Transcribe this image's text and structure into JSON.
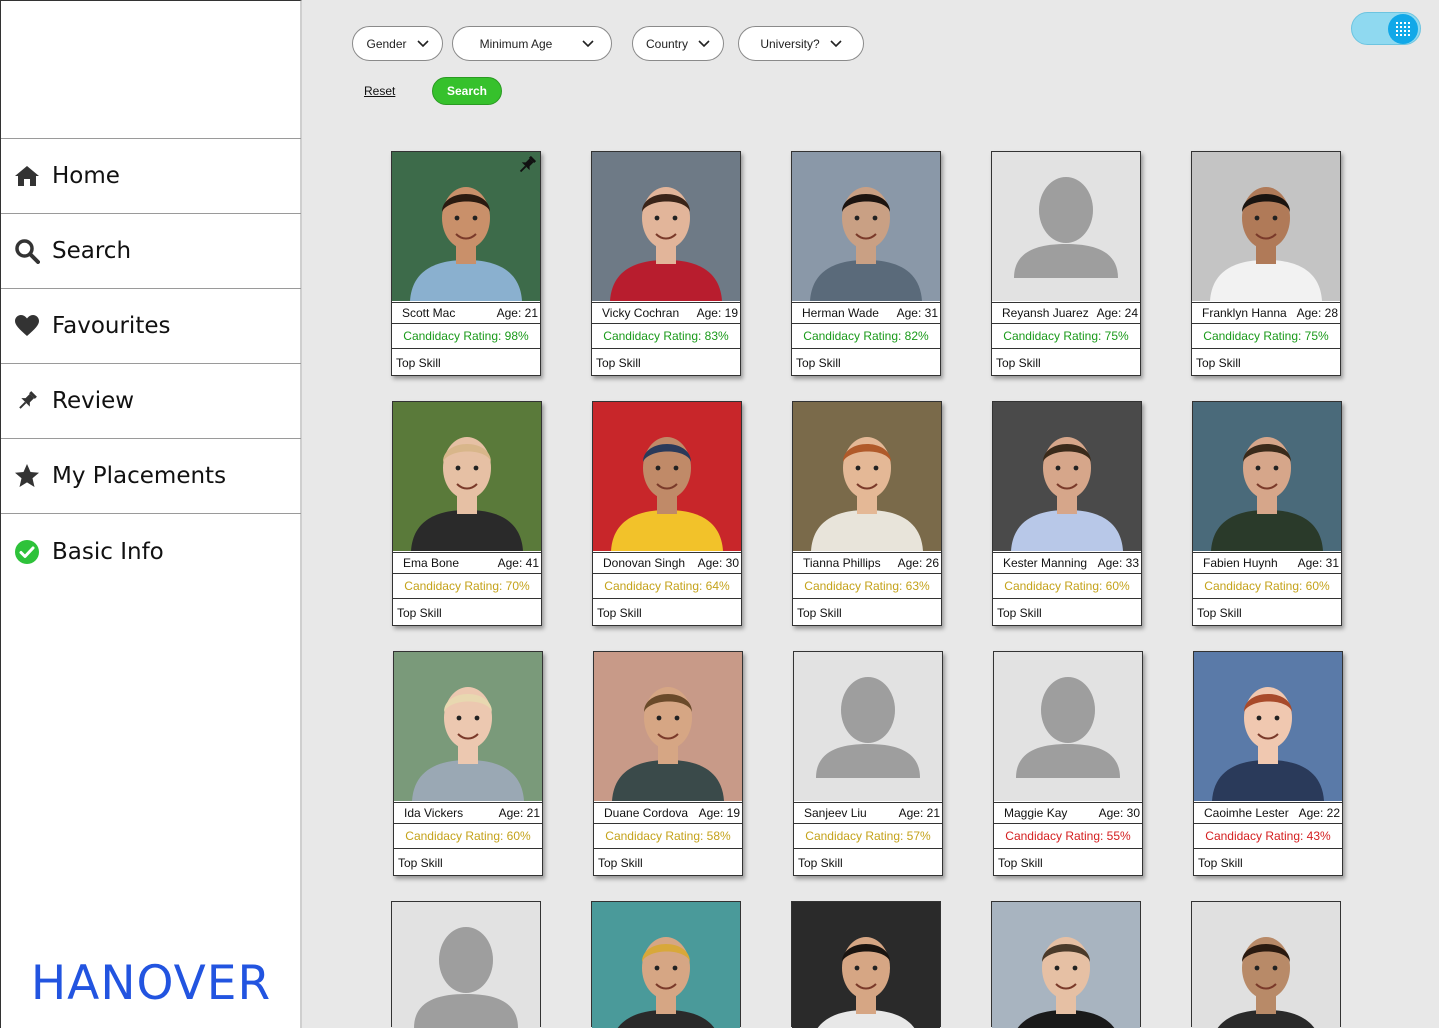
{
  "sidebar": {
    "items": [
      {
        "label": "Home",
        "icon": "home-icon"
      },
      {
        "label": "Search",
        "icon": "search-icon"
      },
      {
        "label": "Favourites",
        "icon": "heart-icon"
      },
      {
        "label": "Review",
        "icon": "pin-icon"
      },
      {
        "label": "My Placements",
        "icon": "star-icon"
      },
      {
        "label": "Basic Info",
        "icon": "check-circle-icon"
      }
    ],
    "brand": "HANOVER"
  },
  "filters": {
    "gender": "Gender",
    "min_age": "Minimum Age",
    "country": "Country",
    "university": "University?",
    "reset": "Reset",
    "search": "Search"
  },
  "colors": {
    "good": "#1a9a1a",
    "mid": "#c4a21a",
    "bad": "#d42020",
    "brand": "#2254e0",
    "search_btn": "#36c12c"
  },
  "candidates": [
    {
      "name": "Scott Mac",
      "age": "Age: 21",
      "rating": "Candidacy Rating: 98%",
      "tier": "good",
      "skill": "Top Skill",
      "pinned": true,
      "photo": true
    },
    {
      "name": "Vicky Cochran",
      "age": "Age: 19",
      "rating": "Candidacy Rating: 83%",
      "tier": "good",
      "skill": "Top Skill",
      "photo": true
    },
    {
      "name": "Herman Wade",
      "age": "Age: 31",
      "rating": "Candidacy Rating: 82%",
      "tier": "good",
      "skill": "Top Skill",
      "photo": true
    },
    {
      "name": "Reyansh Juarez",
      "age": "Age: 24",
      "rating": "Candidacy Rating: 75%",
      "tier": "good",
      "skill": "Top Skill",
      "photo": false
    },
    {
      "name": "Franklyn Hanna",
      "age": "Age: 28",
      "rating": "Candidacy Rating: 75%",
      "tier": "good",
      "skill": "Top Skill",
      "photo": true
    },
    {
      "name": "Ema Bone",
      "age": "Age: 41",
      "rating": "Candidacy Rating: 70%",
      "tier": "mid",
      "skill": "Top Skill",
      "photo": true
    },
    {
      "name": "Donovan Singh",
      "age": "Age: 30",
      "rating": "Candidacy Rating: 64%",
      "tier": "mid",
      "skill": "Top Skill",
      "photo": true
    },
    {
      "name": "Tianna Phillips",
      "age": "Age: 26",
      "rating": "Candidacy Rating: 63%",
      "tier": "mid",
      "skill": "Top Skill",
      "photo": true
    },
    {
      "name": "Kester Manning",
      "age": "Age: 33",
      "rating": "Candidacy Rating: 60%",
      "tier": "mid",
      "skill": "Top Skill",
      "photo": true
    },
    {
      "name": "Fabien Huynh",
      "age": "Age: 31",
      "rating": "Candidacy Rating: 60%",
      "tier": "mid",
      "skill": "Top Skill",
      "photo": true
    },
    {
      "name": "Ida Vickers",
      "age": "Age: 21",
      "rating": "Candidacy Rating: 60%",
      "tier": "mid",
      "skill": "Top Skill",
      "photo": true
    },
    {
      "name": "Duane Cordova",
      "age": "Age: 19",
      "rating": "Candidacy Rating: 58%",
      "tier": "mid",
      "skill": "Top Skill",
      "photo": true
    },
    {
      "name": "Sanjeev Liu",
      "age": "Age: 21",
      "rating": "Candidacy Rating: 57%",
      "tier": "mid",
      "skill": "Top Skill",
      "photo": false
    },
    {
      "name": "Maggie Kay",
      "age": "Age: 30",
      "rating": "Candidacy Rating: 55%",
      "tier": "bad",
      "skill": "Top Skill",
      "photo": false
    },
    {
      "name": "Caoimhe Lester",
      "age": "Age: 22",
      "rating": "Candidacy Rating: 43%",
      "tier": "bad",
      "skill": "Top Skill",
      "photo": true
    }
  ],
  "partial_cards": [
    {
      "photo": false
    },
    {
      "photo": true
    },
    {
      "photo": true
    },
    {
      "photo": true
    },
    {
      "photo": true
    }
  ]
}
